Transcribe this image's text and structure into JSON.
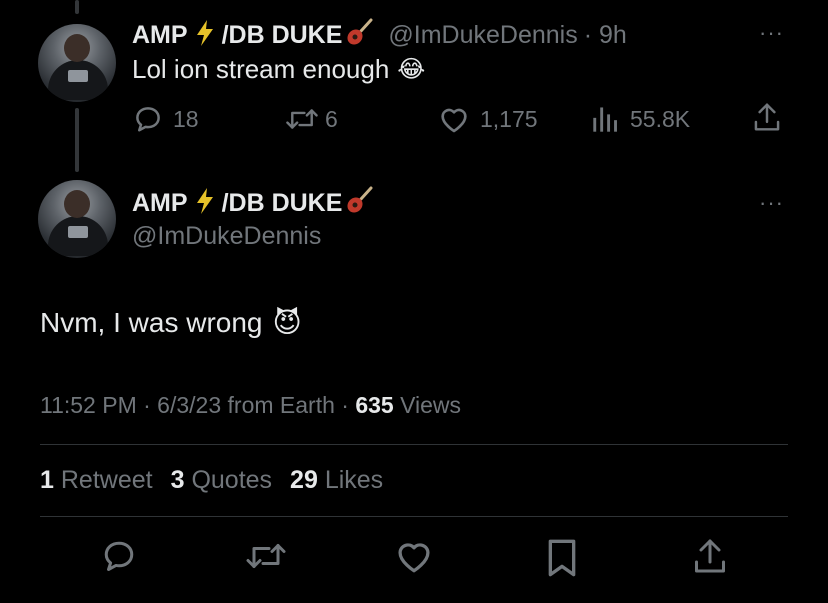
{
  "tweet1": {
    "display_name": "AMP",
    "display_name_suffix": "/DB DUKE",
    "handle": "@ImDukeDennis",
    "time": "· 9h",
    "text": "Lol ion stream enough",
    "emoji": "😂",
    "replies": "18",
    "retweets": "6",
    "likes": "1,175",
    "views": "55.8K",
    "more": "···"
  },
  "tweet2": {
    "display_name": "AMP",
    "display_name_suffix": "/DB DUKE",
    "handle": "@ImDukeDennis",
    "text": "Nvm, I was wrong",
    "emoji": "😈",
    "more": "···",
    "timestamp": "11:52 PM · 6/3/23 from Earth ·",
    "view_count": "635",
    "views_label": "Views",
    "retweet_count": "1",
    "retweet_label": "Retweet",
    "quote_count": "3",
    "quote_label": "Quotes",
    "like_count": "29",
    "like_label": "Likes"
  },
  "icons": {
    "bolt": "lightning-bolt",
    "guitar": "guitar",
    "reply": "reply",
    "retweet": "retweet",
    "like": "heart",
    "views": "analytics",
    "share": "share",
    "bookmark": "bookmark"
  },
  "colors": {
    "background": "#000000",
    "text": "#e7e9ea",
    "muted": "#71767b",
    "bolt": "#e6c229",
    "divider": "#2f3336"
  }
}
